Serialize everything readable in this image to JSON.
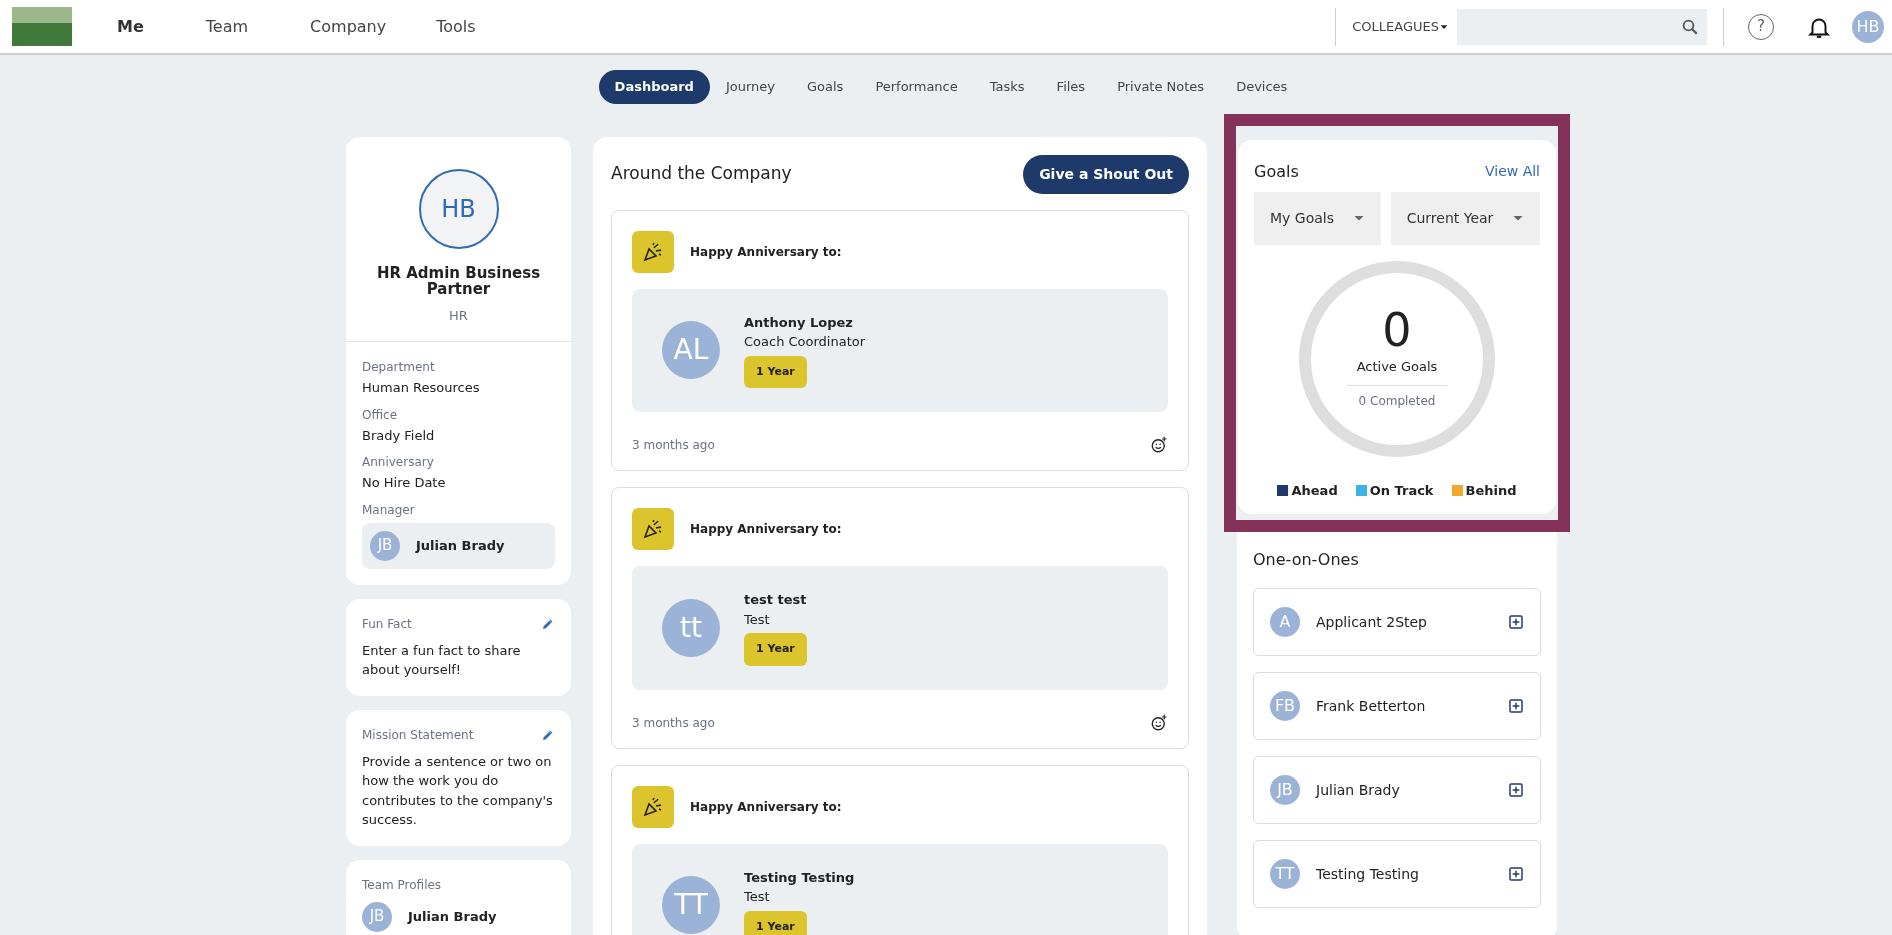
{
  "top_nav": {
    "items": [
      {
        "label": "Me",
        "selected": true
      },
      {
        "label": "Team",
        "selected": false
      },
      {
        "label": "Company",
        "selected": false
      },
      {
        "label": "Tools",
        "selected": false
      }
    ],
    "colleagues": "COLLEAGUES",
    "help": "?",
    "avatar": "HB"
  },
  "sub_nav": [
    {
      "label": "Dashboard",
      "selected": true
    },
    {
      "label": "Journey",
      "selected": false
    },
    {
      "label": "Goals",
      "selected": false
    },
    {
      "label": "Performance",
      "selected": false
    },
    {
      "label": "Tasks",
      "selected": false
    },
    {
      "label": "Files",
      "selected": false
    },
    {
      "label": "Private Notes",
      "selected": false
    },
    {
      "label": "Devices",
      "selected": false
    }
  ],
  "profile": {
    "initials": "HB",
    "name": "HR Admin Business Partner",
    "role": "HR",
    "fields": [
      {
        "label": "Department",
        "value": "Human Resources"
      },
      {
        "label": "Office",
        "value": "Brady Field"
      },
      {
        "label": "Anniversary",
        "value": "No Hire Date"
      }
    ],
    "manager": {
      "label": "Manager",
      "initials": "JB",
      "name": "Julian Brady"
    }
  },
  "info_cards": [
    {
      "title": "Fun Fact",
      "text": "Enter a fun fact to share about yourself!"
    },
    {
      "title": "Mission Statement",
      "text": "Provide a sentence or two on how the work you do contributes to the company's success."
    }
  ],
  "team_profiles": {
    "title": "Team Profiles",
    "members": [
      {
        "initials": "JB",
        "name": "Julian Brady"
      }
    ]
  },
  "feed": {
    "title": "Around the Company",
    "button": "Give a Shout Out",
    "posts": [
      {
        "heading": "Happy Anniversary to:",
        "initials": "AL",
        "name": "Anthony Lopez",
        "job": "Coach Coordinator",
        "badge": "1 Year",
        "time": "3 months ago"
      },
      {
        "heading": "Happy Anniversary to:",
        "initials": "tt",
        "name": "test test",
        "job": "Test",
        "badge": "1 Year",
        "time": "3 months ago"
      },
      {
        "heading": "Happy Anniversary to:",
        "initials": "TT",
        "name": "Testing Testing",
        "job": "Test",
        "badge": "1 Year"
      }
    ]
  },
  "goals": {
    "title": "Goals",
    "link": "View All",
    "filters": [
      "My Goals",
      "Current Year"
    ],
    "count": "0",
    "count_label": "Active Goals",
    "completed": "0 Completed",
    "legend": [
      {
        "label": "Ahead",
        "color": "#1d3a6b"
      },
      {
        "label": "On Track",
        "color": "#3fb1e5"
      },
      {
        "label": "Behind",
        "color": "#f2a72d"
      }
    ]
  },
  "one_on_ones": {
    "title": "One-on-Ones",
    "people": [
      {
        "initials": "A",
        "name": "Applicant 2Step"
      },
      {
        "initials": "FB",
        "name": "Frank Betterton"
      },
      {
        "initials": "JB",
        "name": "Julian Brady"
      },
      {
        "initials": "TT",
        "name": "Testing Testing"
      }
    ]
  }
}
